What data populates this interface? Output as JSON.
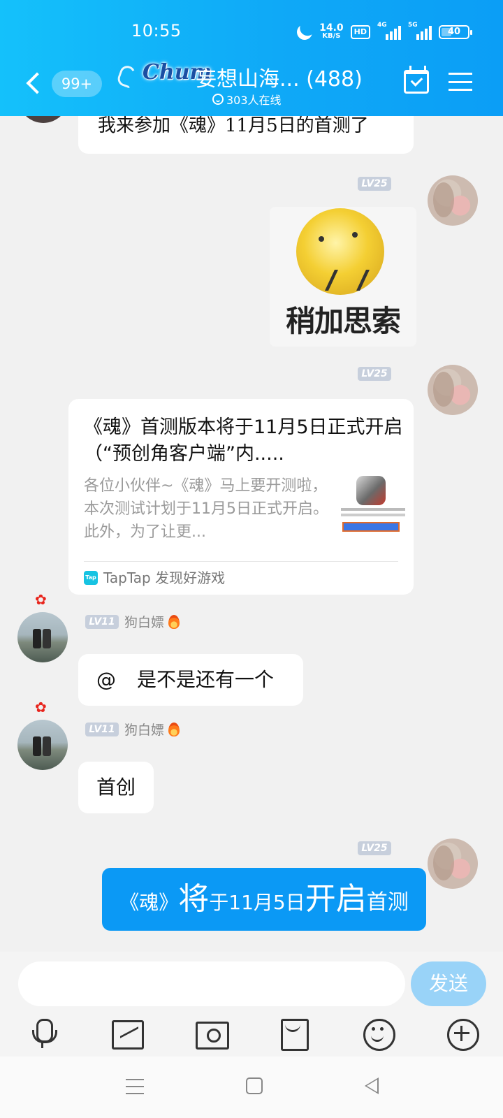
{
  "status_bar": {
    "time": "10:55",
    "net_speed_value": "14.0",
    "net_speed_unit": "KB/S",
    "hd_label": "HD",
    "signal1_label": "4G",
    "signal2_label": "5G",
    "battery_level": "40"
  },
  "header": {
    "unread_count": "99+",
    "group_logo_text": "Chum",
    "group_name": "妄想山海... (488)",
    "online_count": "303人在线"
  },
  "messages": {
    "top_partial": {
      "text": "我来参加《魂》11月5日的首测了"
    },
    "sticker": {
      "level": "LV25",
      "caption": "稍加思索"
    },
    "link_card": {
      "level": "LV25",
      "title": "《魂》首测版本将于11月5日正式开启（“预创角客户端”内.....",
      "description": "各位小伙伴~《魂》马上要开测啦，本次测试计划于11月5日正式开启。此外，为了让更...",
      "source": "TapTap 发现好游戏"
    },
    "reply1": {
      "level": "LV11",
      "nickname": "狗白嫖",
      "at_symbol": "@",
      "text": "是不是还有一个"
    },
    "reply2": {
      "level": "LV11",
      "nickname": "狗白嫖",
      "text": "首创"
    },
    "own_blue": {
      "level": "LV25",
      "part1": "《魂》",
      "part2": "将",
      "part3": "于11月5日",
      "part4": "开启",
      "part5": "首测"
    }
  },
  "input": {
    "placeholder": "",
    "send_label": "发送"
  },
  "toolbar": [
    "mic-icon",
    "image-icon",
    "camera-icon",
    "red-packet-icon",
    "emoji-icon",
    "plus-icon"
  ],
  "colors": {
    "header": "#0fa9f7",
    "own_bubble": "#0b99f5",
    "send_button": "#99d3f8",
    "background": "#f1f1f1"
  }
}
